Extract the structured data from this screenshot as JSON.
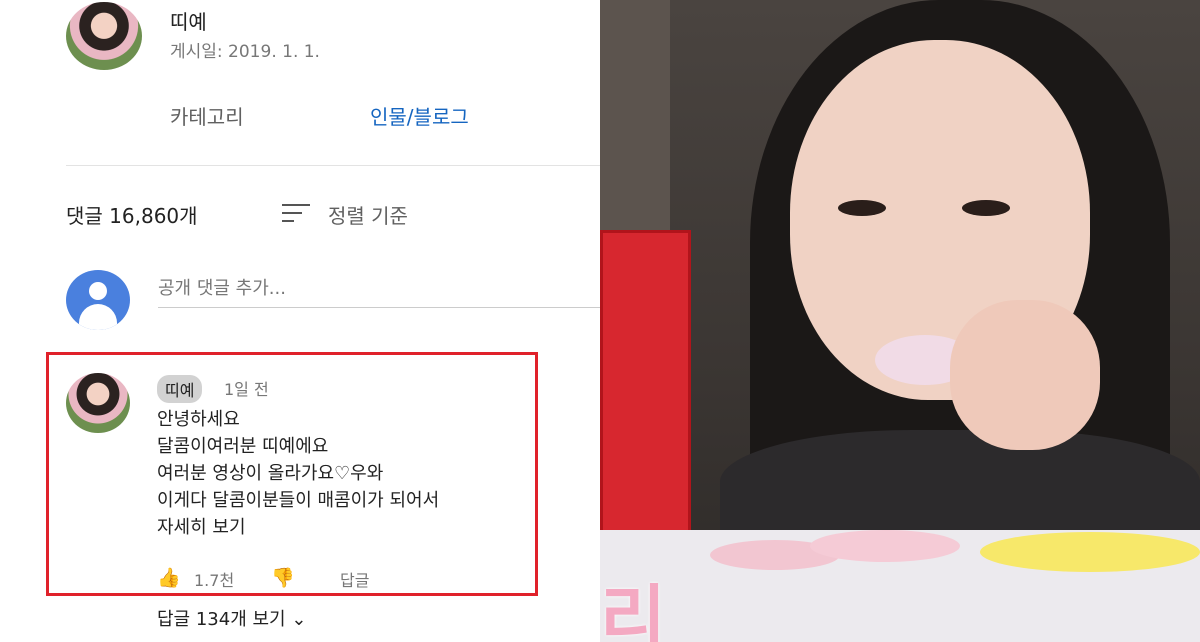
{
  "post": {
    "channel_name": "띠예",
    "date": "게시일: 2019. 1. 1.",
    "category_label": "카테고리",
    "category_value": "인물/블로그"
  },
  "comments_header": {
    "count": "댓글 16,860개",
    "sort_label": "정렬 기준",
    "add_placeholder": "공개 댓글 추가..."
  },
  "comment": {
    "author": "띠예",
    "time": "1일 전",
    "lines": [
      "안녕하세요",
      "달콤이여러분 띠예에요",
      "여러분 영상이 올라가요♡우와",
      "이게다 달콤이분들이 매콤이가 되어서",
      "자세히 보기"
    ],
    "like_count": "1.7천",
    "reply_label": "답글",
    "view_replies": "답글 134개 보기 ⌄"
  },
  "video": {
    "caption": "리"
  },
  "colors": {
    "accent_link": "#1565c0",
    "highlight_border": "#e0212a"
  }
}
